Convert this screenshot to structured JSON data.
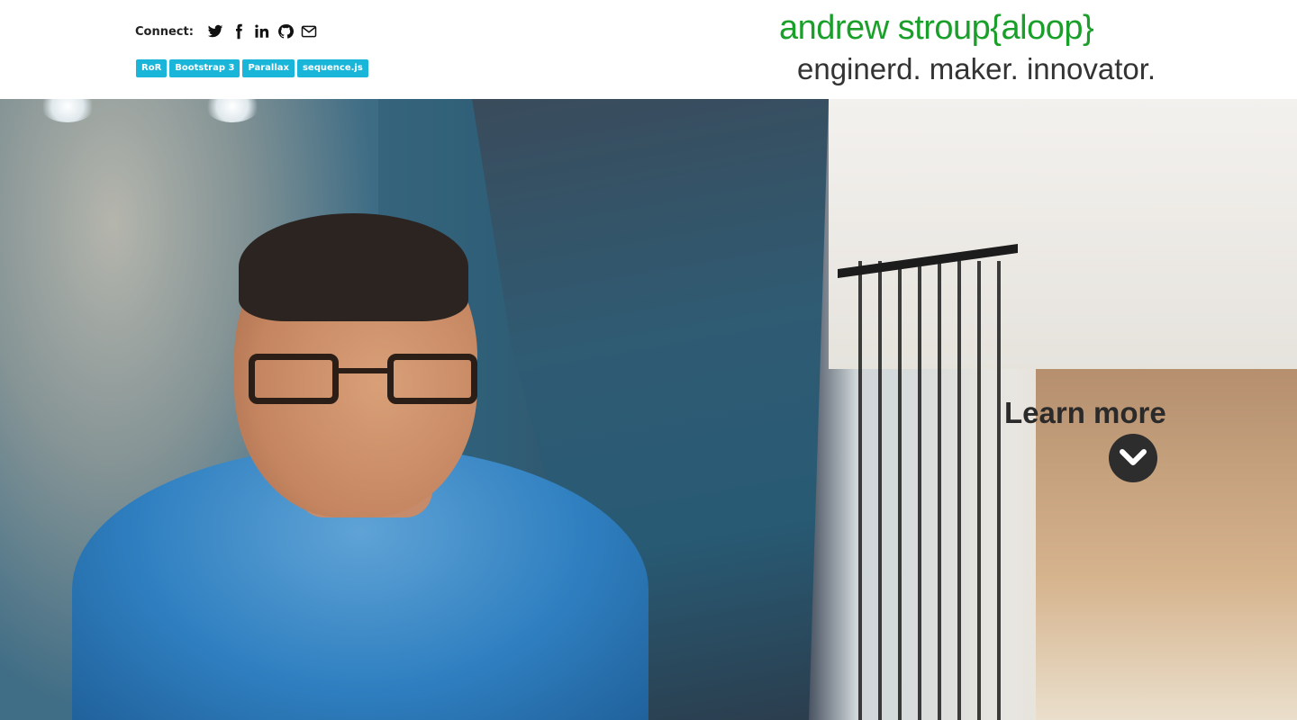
{
  "header": {
    "connect_label": "Connect:",
    "social": [
      {
        "icon": "twitter-icon"
      },
      {
        "icon": "facebook-icon"
      },
      {
        "icon": "linkedin-icon"
      },
      {
        "icon": "github-icon"
      },
      {
        "icon": "email-icon"
      }
    ],
    "tags": [
      "RoR",
      "Bootstrap 3",
      "Parallax",
      "sequence.js"
    ],
    "brand": "andrew stroup{aloop}",
    "tagline": "enginerd. maker. innovator."
  },
  "hero": {
    "cta_label": "Learn more",
    "cta_icon": "chevron-down-icon"
  },
  "colors": {
    "brand": "#1aa02a",
    "tag_bg": "#1ab6d9",
    "tagline": "#333333"
  }
}
